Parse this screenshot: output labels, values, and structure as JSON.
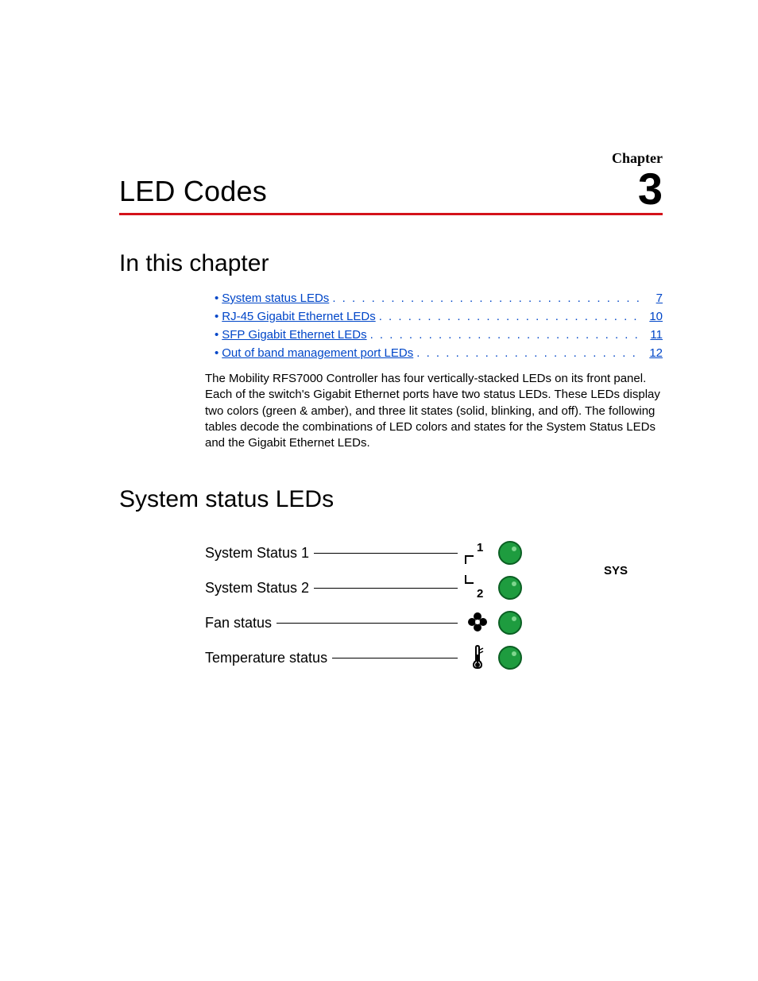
{
  "chapter": {
    "label": "Chapter",
    "number": "3",
    "title": "LED Codes"
  },
  "sections": {
    "in_this_chapter": "In this chapter",
    "system_status_leds": "System status LEDs"
  },
  "toc": [
    {
      "label": "System status LEDs",
      "page": "7"
    },
    {
      "label": "RJ-45 Gigabit Ethernet LEDs",
      "page": "10"
    },
    {
      "label": "SFP Gigabit Ethernet LEDs",
      "page": "11"
    },
    {
      "label": "Out of band management port LEDs",
      "page": "12"
    }
  ],
  "paragraph": "The Mobility RFS7000 Controller has four vertically-stacked LEDs on its front panel. Each of the switch's Gigabit Ethernet ports have two status LEDs. These LEDs display two colors (green & amber), and three lit states (solid, blinking, and off). The following tables decode the combinations of LED colors and states for the System Status LEDs and the Gigabit Ethernet LEDs.",
  "diagram": {
    "rows": [
      {
        "label": "System Status 1",
        "icon": "sys1",
        "led_color": "#1e9c3f"
      },
      {
        "label": "System Status 2",
        "icon": "sys2",
        "led_color": "#1e9c3f"
      },
      {
        "label": "Fan status",
        "icon": "fan",
        "led_color": "#1e9c3f"
      },
      {
        "label": "Temperature status",
        "icon": "therm",
        "led_color": "#1e9c3f"
      }
    ],
    "sys_label": "SYS",
    "sys_1": "1",
    "sys_2": "2"
  }
}
